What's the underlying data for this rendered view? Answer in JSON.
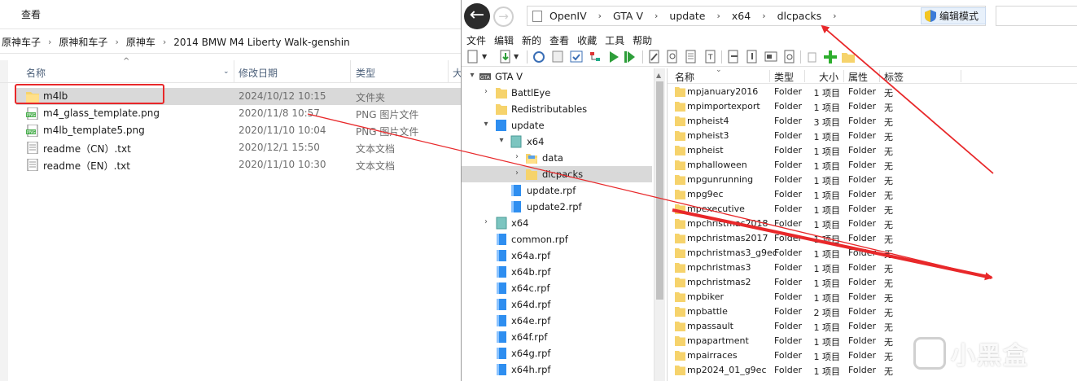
{
  "explorer": {
    "ribbon_tab": "查看",
    "breadcrumb": [
      "原神车子",
      "原神和车子",
      "原神车",
      "2014 BMW M4 Liberty Walk-genshin"
    ],
    "columns": {
      "name": "名称",
      "date": "修改日期",
      "type": "类型",
      "size": "大"
    },
    "files": [
      {
        "name": "m4lb",
        "date": "2024/10/12 10:15",
        "type": "文件夹",
        "icon": "folder-icon",
        "selected": true
      },
      {
        "name": "m4_glass_template.png",
        "date": "2020/11/8 10:57",
        "type": "PNG 图片文件",
        "icon": "png-file-icon"
      },
      {
        "name": "m4lb_template5.png",
        "date": "2020/11/10 10:04",
        "type": "PNG 图片文件",
        "icon": "png-file-icon"
      },
      {
        "name": "readme（CN）.txt",
        "date": "2020/12/1 15:50",
        "type": "文本文档",
        "icon": "text-file-icon"
      },
      {
        "name": "readme（EN）.txt",
        "date": "2020/11/10 10:30",
        "type": "文本文档",
        "icon": "text-file-icon"
      }
    ]
  },
  "openiv": {
    "address": [
      "OpenIV",
      "GTA V",
      "update",
      "x64",
      "dlcpacks"
    ],
    "edit_mode_label": "编辑模式",
    "menu": [
      "文件",
      "编辑",
      "新的",
      "查看",
      "收藏",
      "工具",
      "帮助"
    ],
    "tree": [
      {
        "label": "GTA V",
        "expander": "▾",
        "icon": "gtav-icon",
        "level": 0
      },
      {
        "label": "BattlEye",
        "expander": "›",
        "icon": "folder-icon",
        "level": 1
      },
      {
        "label": "Redistributables",
        "expander": "",
        "icon": "folder-icon",
        "level": 1
      },
      {
        "label": "update",
        "expander": "▾",
        "icon": "blue-folder-icon",
        "level": 1
      },
      {
        "label": "x64",
        "expander": "▾",
        "icon": "archive-icon",
        "level": 2
      },
      {
        "label": "data",
        "expander": "›",
        "icon": "open-folder-icon",
        "level": 3
      },
      {
        "label": "dlcpacks",
        "expander": "›",
        "icon": "folder-icon",
        "level": 3,
        "selected": true
      },
      {
        "label": "update.rpf",
        "expander": "",
        "icon": "rpf-icon",
        "level": 2
      },
      {
        "label": "update2.rpf",
        "expander": "",
        "icon": "rpf-icon",
        "level": 2
      },
      {
        "label": "x64",
        "expander": "›",
        "icon": "archive-icon",
        "level": 1
      },
      {
        "label": "common.rpf",
        "expander": "",
        "icon": "rpf-icon",
        "level": 1
      },
      {
        "label": "x64a.rpf",
        "expander": "",
        "icon": "rpf-icon",
        "level": 1
      },
      {
        "label": "x64b.rpf",
        "expander": "",
        "icon": "rpf-icon",
        "level": 1
      },
      {
        "label": "x64c.rpf",
        "expander": "",
        "icon": "rpf-icon",
        "level": 1
      },
      {
        "label": "x64d.rpf",
        "expander": "",
        "icon": "rpf-icon",
        "level": 1
      },
      {
        "label": "x64e.rpf",
        "expander": "",
        "icon": "rpf-icon",
        "level": 1
      },
      {
        "label": "x64f.rpf",
        "expander": "",
        "icon": "rpf-icon",
        "level": 1
      },
      {
        "label": "x64g.rpf",
        "expander": "",
        "icon": "rpf-icon",
        "level": 1
      },
      {
        "label": "x64h.rpf",
        "expander": "",
        "icon": "rpf-icon",
        "level": 1
      }
    ],
    "list_columns": {
      "name": "名称",
      "type": "类型",
      "size": "大小",
      "attr": "属性",
      "tag": "标签"
    },
    "list": [
      {
        "name": "mpjanuary2016",
        "type": "Folder",
        "size": "1 项目",
        "attr": "Folder",
        "tag": "无"
      },
      {
        "name": "mpimportexport",
        "type": "Folder",
        "size": "1 项目",
        "attr": "Folder",
        "tag": "无"
      },
      {
        "name": "mpheist4",
        "type": "Folder",
        "size": "3 项目",
        "attr": "Folder",
        "tag": "无"
      },
      {
        "name": "mpheist3",
        "type": "Folder",
        "size": "1 项目",
        "attr": "Folder",
        "tag": "无"
      },
      {
        "name": "mpheist",
        "type": "Folder",
        "size": "1 项目",
        "attr": "Folder",
        "tag": "无"
      },
      {
        "name": "mphalloween",
        "type": "Folder",
        "size": "1 项目",
        "attr": "Folder",
        "tag": "无"
      },
      {
        "name": "mpgunrunning",
        "type": "Folder",
        "size": "1 项目",
        "attr": "Folder",
        "tag": "无"
      },
      {
        "name": "mpg9ec",
        "type": "Folder",
        "size": "1 项目",
        "attr": "Folder",
        "tag": "无"
      },
      {
        "name": "mpexecutive",
        "type": "Folder",
        "size": "1 项目",
        "attr": "Folder",
        "tag": "无"
      },
      {
        "name": "mpchristmas2018",
        "type": "Folder",
        "size": "1 项目",
        "attr": "Folder",
        "tag": "无"
      },
      {
        "name": "mpchristmas2017",
        "type": "Folder",
        "size": "1 项目",
        "attr": "Folder",
        "tag": "无"
      },
      {
        "name": "mpchristmas3_g9ec",
        "type": "Folder",
        "size": "1 项目",
        "attr": "Folder",
        "tag": "无"
      },
      {
        "name": "mpchristmas3",
        "type": "Folder",
        "size": "1 项目",
        "attr": "Folder",
        "tag": "无"
      },
      {
        "name": "mpchristmas2",
        "type": "Folder",
        "size": "1 项目",
        "attr": "Folder",
        "tag": "无"
      },
      {
        "name": "mpbiker",
        "type": "Folder",
        "size": "1 项目",
        "attr": "Folder",
        "tag": "无"
      },
      {
        "name": "mpbattle",
        "type": "Folder",
        "size": "2 项目",
        "attr": "Folder",
        "tag": "无"
      },
      {
        "name": "mpassault",
        "type": "Folder",
        "size": "1 项目",
        "attr": "Folder",
        "tag": "无"
      },
      {
        "name": "mpapartment",
        "type": "Folder",
        "size": "1 项目",
        "attr": "Folder",
        "tag": "无"
      },
      {
        "name": "mpairraces",
        "type": "Folder",
        "size": "1 项目",
        "attr": "Folder",
        "tag": "无"
      },
      {
        "name": "mp2024_01_g9ec",
        "type": "Folder",
        "size": "1 项目",
        "attr": "Folder",
        "tag": "无"
      }
    ]
  },
  "watermark": "小黑盒",
  "colors": {
    "annotation_red": "#e8282a",
    "folder_yellow": "#f6d36c",
    "rpf_blue": "#2e8ef0",
    "selection_gray": "#d9d9d9"
  }
}
